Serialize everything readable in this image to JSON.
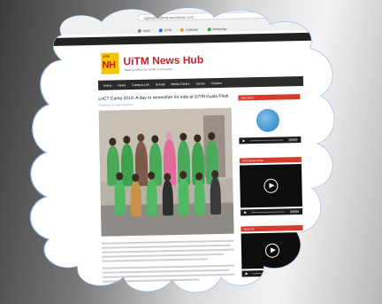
{
  "browser": {
    "address": "appliedcreativity.wordpress.com",
    "tab_text": "UiTM News Hub",
    "bookmarks": [
      {
        "label": "Apps",
        "color": "#888888"
      },
      {
        "label": "UiTM",
        "color": "#3a6fd8"
      },
      {
        "label": "Calendar",
        "color": "#d8a23a"
      },
      {
        "label": "WhatsApp",
        "color": "#3aa84a"
      }
    ]
  },
  "site": {
    "logo_small": "UiTM",
    "logo_big": "NH",
    "title": "UiTM News Hub",
    "tagline": "Making News for UiTM Community",
    "nav": [
      "Home",
      "News",
      "Campus Life",
      "Events",
      "Media Centre",
      "Sports",
      "Contact"
    ]
  },
  "article": {
    "title": "LoCT Camp 2019: A day to remember for kids at UiTM Kuala Pilah",
    "meta": "Posted on 2019 by NewsHub"
  },
  "sidebar": {
    "heading_1": "Hello World",
    "heading_2": "UiTM Media Centre",
    "heading_3": "Watch Us"
  },
  "colors": {
    "accent": "#c8232c",
    "sidebar_heading": "#d63b2b",
    "logo_bg": "#f2c500",
    "nav_bg": "#2b2b2b"
  }
}
